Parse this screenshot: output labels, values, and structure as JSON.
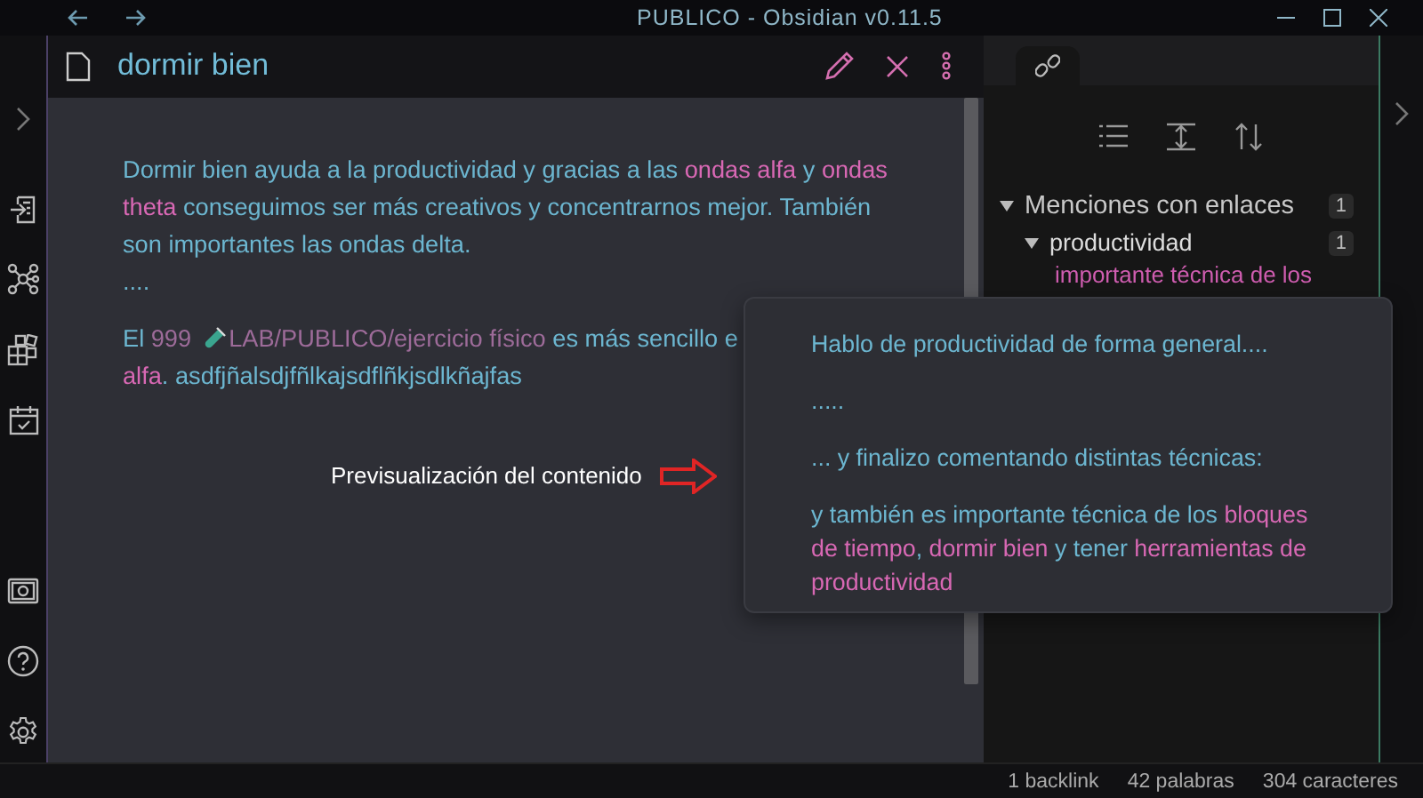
{
  "window": {
    "title": "PUBLICO - Obsidian v0.11.5"
  },
  "note": {
    "title": "dormir bien",
    "paragraphs": [
      {
        "segments": [
          {
            "kind": "text",
            "text": "Dormir bien ayuda a la productividad y gracias a las "
          },
          {
            "kind": "link",
            "text": "ondas alfa"
          },
          {
            "kind": "text",
            "text": " y "
          },
          {
            "kind": "link",
            "text": "ondas theta"
          },
          {
            "kind": "text",
            "text": " conseguimos ser más creativos y concentrarnos mejor. También son importantes las ondas delta."
          },
          {
            "kind": "break"
          },
          {
            "kind": "text",
            "text": "...."
          }
        ]
      },
      {
        "segments": [
          {
            "kind": "text",
            "text": "El "
          },
          {
            "kind": "muted",
            "text": "999"
          },
          {
            "kind": "embed",
            "text": "LAB/PUBLICO/ejercicio físico"
          },
          {
            "kind": "text",
            "text": " es más sencillo e"
          },
          {
            "kind": "break"
          },
          {
            "kind": "link",
            "text": "alfa"
          },
          {
            "kind": "text",
            "text": ". asdfjñalsdjfñlkajsdflñkjsdlkñajfas"
          }
        ]
      }
    ]
  },
  "backlinks": {
    "section": "Menciones con enlaces",
    "count": "1",
    "expanded": true,
    "files": [
      {
        "name": "productividad",
        "count": "1",
        "expanded": true,
        "snippet": [
          "importante técnica de los"
        ]
      }
    ]
  },
  "preview": {
    "paragraphs": [
      {
        "segments": [
          {
            "kind": "text",
            "text": "Hablo de productividad de forma general...."
          }
        ]
      },
      {
        "segments": [
          {
            "kind": "text",
            "text": "....."
          }
        ]
      },
      {
        "segments": [
          {
            "kind": "text",
            "text": "... y finalizo comentando distintas técnicas:"
          }
        ]
      },
      {
        "segments": [
          {
            "kind": "text",
            "text": "y también es importante técnica de los "
          },
          {
            "kind": "link",
            "text": "bloques de tiempo"
          },
          {
            "kind": "text",
            "text": ", "
          },
          {
            "kind": "link",
            "text": "dormir bien"
          },
          {
            "kind": "text",
            "text": " y tener "
          },
          {
            "kind": "link",
            "text": "herramientas de productividad"
          }
        ]
      }
    ]
  },
  "annotation": {
    "text": "Previsualización del contenido"
  },
  "status_bar": [
    "1 backlink",
    "42 palabras",
    "304 caracteres"
  ]
}
